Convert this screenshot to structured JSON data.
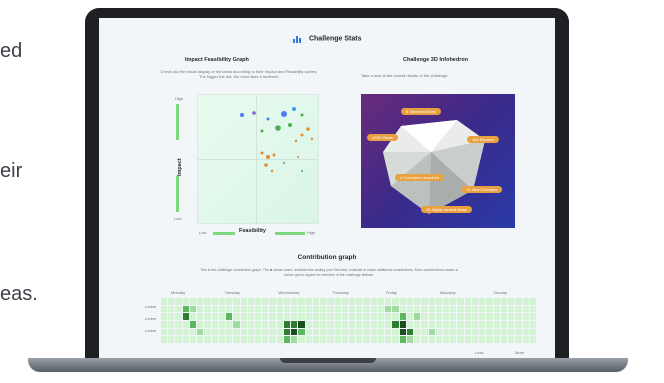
{
  "background_text": {
    "line1": "ed",
    "line2": "eir",
    "line3": "eas."
  },
  "app": {
    "title": "Challenge Stats"
  },
  "impact": {
    "title": "Impact Feasibility Graph",
    "description": "Check out the visual display of the ideas according to their Impact and Feasibility scores. The bigger the dot, the more likes it received.",
    "y_label": "Impact",
    "y_high": "High",
    "y_low": "Low",
    "x_label": "Feasibility",
    "x_low": "Low",
    "x_high": "High"
  },
  "infohedron": {
    "title": "Challenge 3D Infohedron",
    "description": "Take a look at the overall results of the challenge.",
    "badges": [
      {
        "value": "6",
        "label": "Selected ideas"
      },
      {
        "value": "1200",
        "label": "Views"
      },
      {
        "value": "168",
        "label": "Election"
      },
      {
        "value": "4",
        "label": "Concepts Launched"
      },
      {
        "value": "12",
        "label": "Idea Concepts"
      },
      {
        "value": "45",
        "label": "Highly ranked ideas"
      }
    ]
  },
  "contribution": {
    "title": "Contribution graph",
    "description": "This is the challenge contribution graph. The ■ shows users' activities like adding your first idea, evaluate or make additional contributions. More contributions means a darker green square for that time of the challenge lifetime.",
    "days": [
      "Monday",
      "Tuesday",
      "Wednesday",
      "Thursday",
      "Friday",
      "Saturday",
      "Sunday"
    ],
    "row_labels": [
      "Lorem",
      "Lorem",
      "Lorem"
    ],
    "legend_less": "Less",
    "legend_more": "More"
  },
  "colors": {
    "accent": "#2f7de1",
    "green_light": "#c6f0c6",
    "green_dark": "#2e7d32"
  }
}
